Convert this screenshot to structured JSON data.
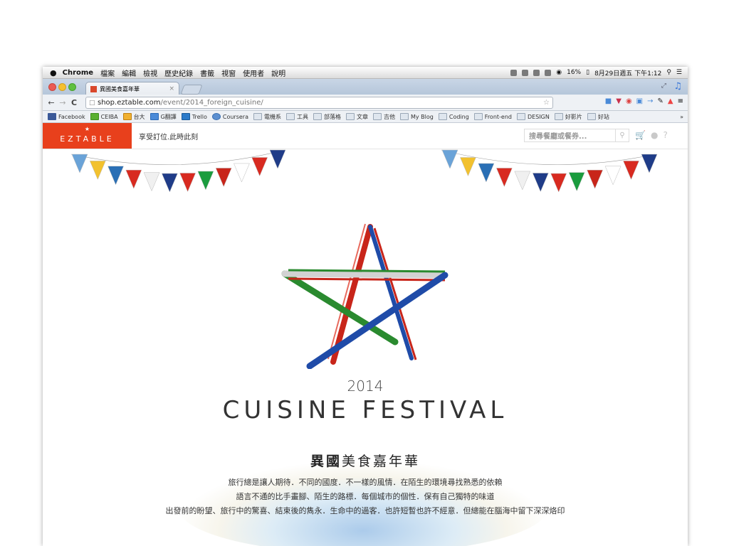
{
  "menubar": {
    "app": "Chrome",
    "items": [
      "檔案",
      "編輯",
      "檢視",
      "歷史紀錄",
      "書籤",
      "視窗",
      "使用者",
      "說明"
    ],
    "battery": "16%",
    "clock": "8月29日週五 下午1:12"
  },
  "tab": {
    "title": "異國美食嘉年華",
    "close": "×"
  },
  "toolbar": {
    "back": "←",
    "forward": "→",
    "reload": "C",
    "url_host": "shop.eztable.com",
    "url_path": "/event/2014_foreign_cuisine/",
    "menu": "≡"
  },
  "bookmarks": [
    "Facebook",
    "CEIBA",
    "台大",
    "G翻譯",
    "Trello",
    "Coursera",
    "電機系",
    "工具",
    "部落格",
    "文章",
    "吉他",
    "My Blog",
    "Coding",
    "Front-end",
    "DESIGN",
    "好影片",
    "好站"
  ],
  "bookmarks_more": "»",
  "site": {
    "logo": "EZTABLE",
    "logo_star": "★",
    "tagline": "享受訂位.此時此刻",
    "search_placeholder": "搜尋餐廳或餐券...",
    "search_icon": "magnifier-icon",
    "icons": [
      "cart-icon",
      "user-icon",
      "help-icon"
    ]
  },
  "event": {
    "year": "2014",
    "festival": "CUISINE FESTIVAL",
    "title_bold": "異國",
    "title_rest": "美食嘉年華",
    "paragraph": [
      "旅行總是讓人期待．不同的國度．不一樣的風情．在陌生的環境尋找熟悉的依賴",
      "語言不通的比手畫腳、陌生的路標．每個城市的個性．保有自己獨特的味道",
      "出發前的盼望、旅行中的驚喜、結束後的雋永．生命中的過客．也許短暫也許不經意．但總能在腦海中留下深深烙印"
    ]
  },
  "colors": {
    "brand": "#e8401c",
    "star_red": "#c8251a",
    "star_blue": "#1f4ba8",
    "star_green": "#2a8a2f"
  }
}
